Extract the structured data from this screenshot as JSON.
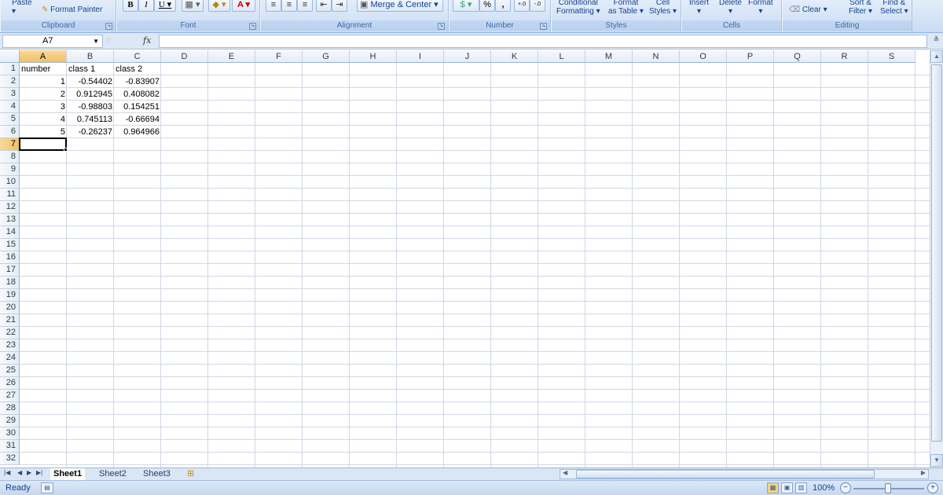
{
  "ribbon": {
    "clipboard": {
      "group": "Clipboard",
      "paste": "Paste",
      "format_painter": "Format Painter"
    },
    "font": {
      "group": "Font",
      "bold": "B",
      "italic": "I",
      "underline": "U",
      "font_color": "A"
    },
    "alignment": {
      "group": "Alignment",
      "merge_center": "Merge & Center"
    },
    "number": {
      "group": "Number",
      "percent": "%",
      "comma": ",",
      "inc_decimal": ".0→.00",
      "dec_decimal": ".00→.0"
    },
    "styles": {
      "group": "Styles",
      "conditional": "Conditional",
      "conditional2": "Formatting",
      "format": "Format",
      "format2": "as Table",
      "cell": "Cell",
      "cell2": "Styles"
    },
    "cells": {
      "group": "Cells",
      "insert": "Insert",
      "delete": "Delete",
      "format": "Format"
    },
    "editing": {
      "group": "Editing",
      "clear": "Clear",
      "sort": "Sort &",
      "sort2": "Filter",
      "find": "Find &",
      "find2": "Select"
    }
  },
  "formula_bar": {
    "name_box": "A7",
    "fx": "fx",
    "formula": ""
  },
  "columns": [
    "A",
    "B",
    "C",
    "D",
    "E",
    "F",
    "G",
    "H",
    "I",
    "J",
    "K",
    "L",
    "M",
    "N",
    "O",
    "P",
    "Q",
    "R",
    "S"
  ],
  "rows": [
    "1",
    "2",
    "3",
    "4",
    "5",
    "6",
    "7",
    "8",
    "9",
    "10",
    "11",
    "12",
    "13",
    "14",
    "15",
    "16",
    "17",
    "18",
    "19",
    "20",
    "21",
    "22",
    "23",
    "24",
    "25",
    "26",
    "27",
    "28",
    "29",
    "30",
    "31",
    "32"
  ],
  "cells": {
    "header": [
      "number",
      "class 1",
      "class 2"
    ],
    "data": [
      [
        "1",
        "-0.54402",
        "-0.83907"
      ],
      [
        "2",
        "0.912945",
        "0.408082"
      ],
      [
        "3",
        "-0.98803",
        "0.154251"
      ],
      [
        "4",
        "0.745113",
        "-0.66694"
      ],
      [
        "5",
        "-0.26237",
        "0.964966"
      ]
    ]
  },
  "active_cell": "A7",
  "sheets": [
    "Sheet1",
    "Sheet2",
    "Sheet3"
  ],
  "active_sheet": "Sheet1",
  "status": {
    "text": "Ready",
    "zoom": "100%"
  }
}
